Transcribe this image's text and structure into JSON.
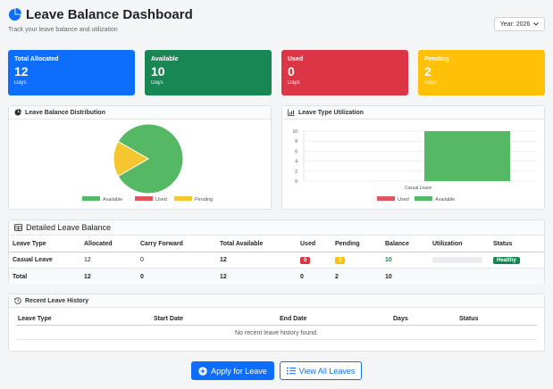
{
  "header": {
    "title": "Leave Balance Dashboard",
    "subtitle": "Track your leave balance and utilization",
    "year_label": "Year: 2026"
  },
  "cards": [
    {
      "label": "Total Allocated",
      "value": "12",
      "unit": "Days",
      "color": "#0d6efd"
    },
    {
      "label": "Available",
      "value": "10",
      "unit": "Days",
      "color": "#198754"
    },
    {
      "label": "Used",
      "value": "0",
      "unit": "Days",
      "color": "#dc3545"
    },
    {
      "label": "Pending",
      "value": "2",
      "unit": "Days",
      "color": "#ffc107"
    }
  ],
  "distribution": {
    "title": "Leave Balance Distribution",
    "chart_data": {
      "type": "pie",
      "categories": [
        "Available",
        "Used",
        "Pending"
      ],
      "values": [
        10,
        0,
        2
      ],
      "colors": [
        "#54b865",
        "#e0545e",
        "#f5c630"
      ],
      "legend": "bottom"
    }
  },
  "utilization": {
    "title": "Leave Type Utilization",
    "chart_data": {
      "type": "bar",
      "categories": [
        "Casual Leave"
      ],
      "series": [
        {
          "name": "Used",
          "values": [
            0
          ],
          "color": "#e0545e"
        },
        {
          "name": "Available",
          "values": [
            10
          ],
          "color": "#54b865"
        }
      ],
      "ylim": [
        0,
        10
      ],
      "yticks": [
        "0",
        "2",
        "4",
        "6",
        "8",
        "10"
      ],
      "stacked": true,
      "legend": "bottom"
    }
  },
  "detailed": {
    "title": "Detailed Leave Balance",
    "headers": [
      "Leave Type",
      "Allocated",
      "Carry Forward",
      "Total Available",
      "Used",
      "Pending",
      "Balance",
      "Utilization",
      "Status"
    ],
    "row": {
      "type": "Casual Leave",
      "allocated": "12",
      "carry": "0",
      "total": "12",
      "used": "0",
      "pending": "2",
      "balance": "10",
      "utilization": 0,
      "status": "Healthy"
    },
    "total": {
      "label": "Total",
      "allocated": "12",
      "carry": "0",
      "total": "12",
      "used": "0",
      "pending": "2",
      "balance": "10"
    }
  },
  "history": {
    "title": "Recent Leave History",
    "headers": [
      "Leave Type",
      "Start Date",
      "End Date",
      "Days",
      "Status"
    ],
    "empty": "No recent leave history found."
  },
  "actions": {
    "apply": "Apply for Leave",
    "view_all": "View All Leaves"
  }
}
